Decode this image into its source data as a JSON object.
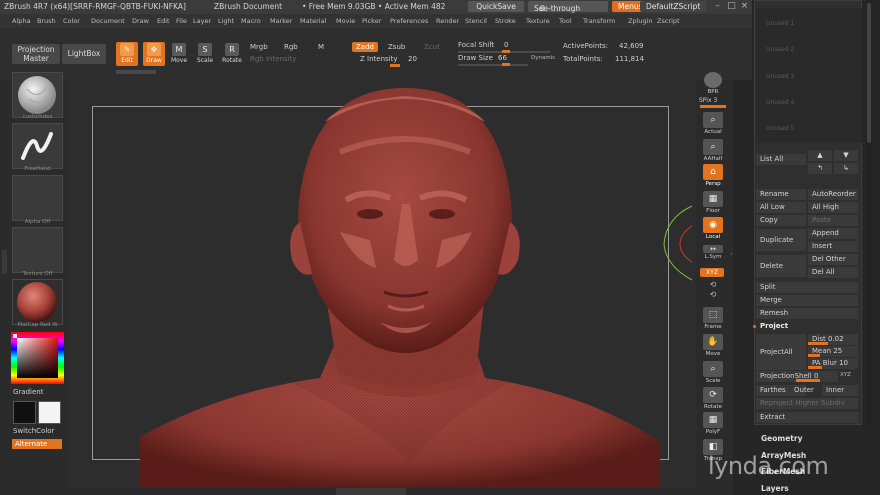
{
  "titlebar": {
    "app": "ZBrush 4R7 (x64)[SRRF-RMGF-QBTB-FUKI-NFKA]",
    "document": "ZBrush Document",
    "free_mem": "• Free Mem 9.03GB • Active Mem 482",
    "quicksave": "QuickSave",
    "seethrough": "See-through",
    "seethrough_value": "0",
    "menus": "Menus",
    "zscript": "DefaultZScript"
  },
  "menubar": {
    "items": [
      "Alpha",
      "Brush",
      "Color",
      "Document",
      "Draw",
      "Edit",
      "File",
      "Layer",
      "Light",
      "Macro",
      "Marker",
      "Material",
      "Movie",
      "Picker",
      "Preferences",
      "Render",
      "Stencil",
      "Stroke",
      "Texture",
      "Tool",
      "Transform",
      "Zplugin",
      "Zscript"
    ]
  },
  "shelf": {
    "projection_master": "Projection Master",
    "lightbox": "LightBox",
    "edit": "Edit",
    "draw": "Draw",
    "move": "Move",
    "scale": "Scale",
    "rotate": "Rotate",
    "mrgb": "Mrgb",
    "rgb": "Rgb",
    "m": "M",
    "rgb_intensity": "Rgb Intensity",
    "zadd": "Zadd",
    "zsub": "Zsub",
    "zcut": "Zcut",
    "z_intensity_label": "Z Intensity",
    "z_intensity": "20",
    "focal_shift_label": "Focal Shift",
    "focal_shift": "0",
    "draw_size_label": "Draw Size",
    "draw_size": "66",
    "dynamic": "Dynamic",
    "active_points_label": "ActivePoints:",
    "active_points": "42,609",
    "total_points_label": "TotalPoints:",
    "total_points": "111,814"
  },
  "leftshelf": {
    "brush_label": "customdes",
    "stroke_label": "FreeHand",
    "alpha_label": "Alpha Off",
    "texture_label": "Texture Off",
    "material_label": "MatCap Red W",
    "gradient": "Gradient",
    "switchcolor": "SwitchColor",
    "alternate": "Alternate"
  },
  "rightshelf": {
    "bpr": "BPR",
    "spix": "SPix",
    "spix_value": "3",
    "actual": "Actual",
    "aahalf": "AAHalf",
    "persp": "Persp",
    "floor": "Floor",
    "local": "Local",
    "lsym": "L.Sym",
    "xyz": "XYZ",
    "frame": "Frame",
    "move": "Move",
    "scale": "Scale",
    "rotate": "Rotate",
    "polyf": "PolyF",
    "transp": "Transp"
  },
  "rightpanel": {
    "slots": [
      "Unused 1",
      "Unused 2",
      "Unused 3",
      "Unused 4",
      "Unused 5"
    ],
    "list_all": "List All",
    "rename": "Rename",
    "autoreorder": "AutoReorder",
    "all_low": "All Low",
    "all_high": "All High",
    "copy": "Copy",
    "paste": "Paste",
    "append": "Append",
    "duplicate": "Duplicate",
    "insert": "Insert",
    "delete": "Delete",
    "del_other": "Del Other",
    "del_all": "Del All",
    "split": "Split",
    "merge": "Merge",
    "remesh": "Remesh",
    "project": "Project",
    "dist_label": "Dist",
    "dist": "0.02",
    "mean_label": "Mean",
    "mean": "25",
    "pa_blur_label": "PA Blur",
    "pa_blur": "10",
    "projectall": "ProjectAll",
    "projectionshell_label": "ProjectionShell",
    "projectionshell": "0",
    "xyz": "XYZ",
    "farthest": "Farthes",
    "outer": "Outer",
    "inner": "Inner",
    "reproject": "Reproject Higher Subdiv",
    "extract": "Extract",
    "geometry": "Geometry",
    "arraymesh": "ArrayMesh",
    "fibermesh": "FiberMesh",
    "layers": "Layers"
  },
  "watermark": "lynda.com",
  "colors": {
    "accent": "#e27420",
    "viewport_bg": "#2d2d2d",
    "sculpt_base": "#8f3b36",
    "sculpt_light": "#c0655b"
  }
}
